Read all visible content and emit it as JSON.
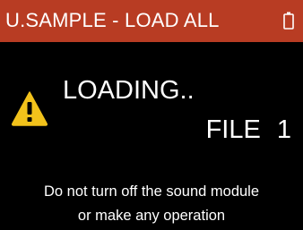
{
  "header": {
    "title": "U.SAMPLE - LOAD ALL",
    "background_color": "#b83c23",
    "battery_icon": "battery-icon"
  },
  "status": {
    "icon": "warning-icon",
    "icon_color": "#f2c21b",
    "loading_label": "LOADING..",
    "file_label": "FILE 1"
  },
  "message": {
    "line1": "Do not turn off the sound module",
    "line2": "or make any operation"
  }
}
